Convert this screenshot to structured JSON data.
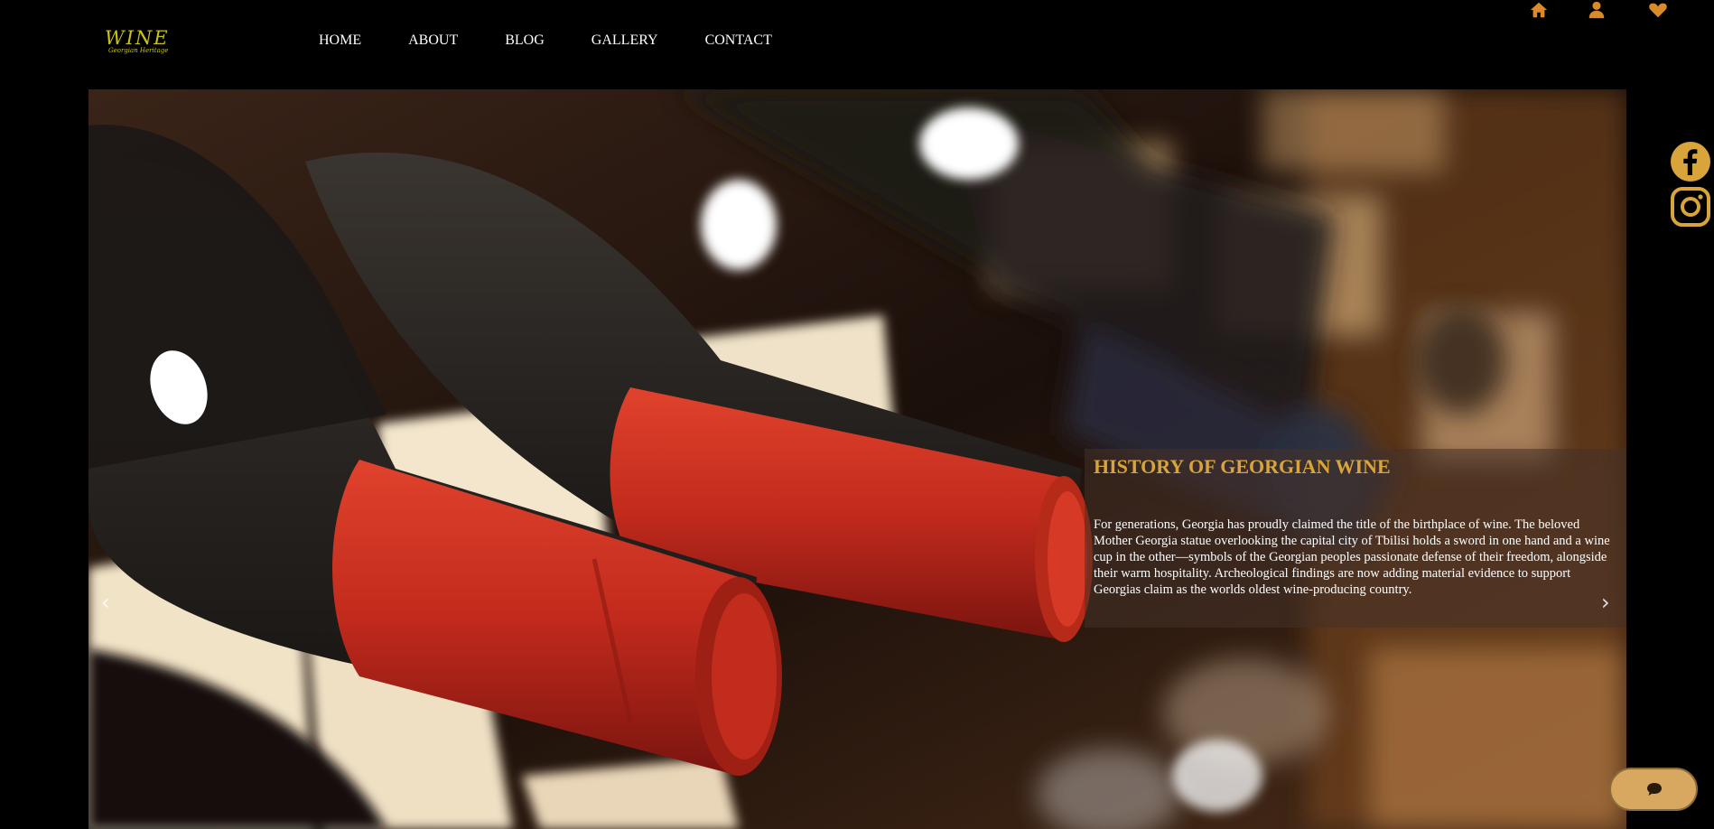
{
  "logo": {
    "text": "WINE",
    "subtext": "Georgian Heritage"
  },
  "nav": {
    "items": [
      "HOME",
      "ABOUT",
      "BLOG",
      "GALLERY",
      "CONTACT"
    ]
  },
  "header_icons": [
    "home-icon",
    "user-icon",
    "heart-icon"
  ],
  "social_icons": [
    "facebook-icon",
    "instagram-icon"
  ],
  "hero": {
    "title": "HISTORY OF GEORGIAN WINE",
    "body": "For generations, Georgia has proudly claimed the title of the birthplace of wine. The beloved Mother Georgia statue overlooking the capital city of Tbilisi holds a sword in one hand and a wine cup in the other—symbols of the Georgian peoples passionate defense of their freedom, alongside their warm hospitality. Archeological findings are now adding material evidence to support Georgias claim as the worlds oldest wine-producing country.",
    "prev_label": "‹",
    "next_label": "›"
  },
  "colors": {
    "accent": "#d9a53a",
    "icon": "#d98a2b",
    "background": "#000000",
    "chat_button": "#d9a860"
  }
}
